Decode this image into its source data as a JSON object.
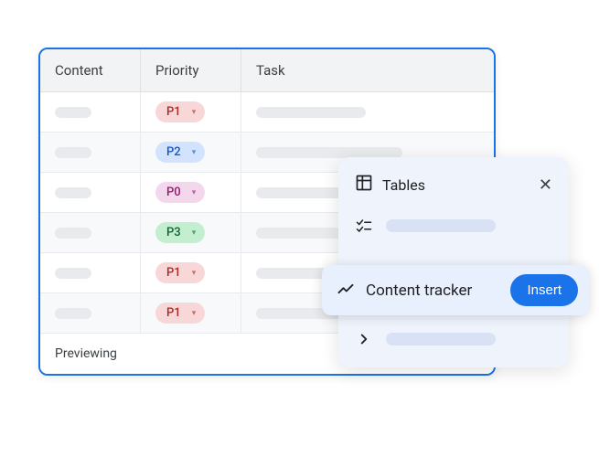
{
  "table": {
    "headers": {
      "content": "Content",
      "priority": "Priority",
      "task": "Task"
    },
    "rows": [
      {
        "priority": "P1",
        "chipClass": "chip-p1"
      },
      {
        "priority": "P2",
        "chipClass": "chip-p2"
      },
      {
        "priority": "P0",
        "chipClass": "chip-p0"
      },
      {
        "priority": "P3",
        "chipClass": "chip-p3"
      },
      {
        "priority": "P1",
        "chipClass": "chip-p1"
      },
      {
        "priority": "P1",
        "chipClass": "chip-p1"
      }
    ],
    "footer": "Previewing"
  },
  "popup": {
    "title": "Tables",
    "highlighted": {
      "label": "Content tracker",
      "action": "Insert"
    }
  }
}
